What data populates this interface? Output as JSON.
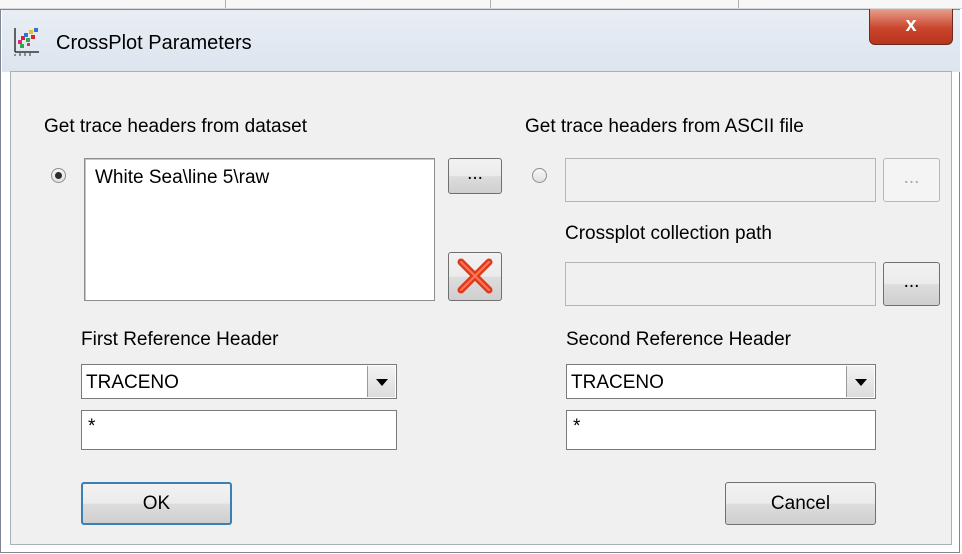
{
  "window": {
    "title": "CrossPlot Parameters",
    "close_glyph": "x"
  },
  "dataset_section": {
    "label": "Get trace headers from dataset",
    "selected": true,
    "dataset_value": "White Sea\\line 5\\raw",
    "browse_label": "...",
    "remove_icon": "red-x-delete-icon"
  },
  "ascii_section": {
    "label": "Get trace headers from ASCII file",
    "selected": false,
    "file_value": "",
    "browse_label": "..."
  },
  "collection": {
    "label": "Crossplot collection path",
    "path_value": "",
    "browse_label": "..."
  },
  "first_reference": {
    "label": "First Reference Header",
    "selected": "TRACENO",
    "filter": "*"
  },
  "second_reference": {
    "label": "Second Reference Header",
    "selected": "TRACENO",
    "filter": "*"
  },
  "buttons": {
    "ok": "OK",
    "cancel": "Cancel"
  },
  "colors": {
    "accent_close": "#c9452c",
    "delete_icon": "#e03a1e",
    "dialog_bg": "#f0f0f0"
  }
}
